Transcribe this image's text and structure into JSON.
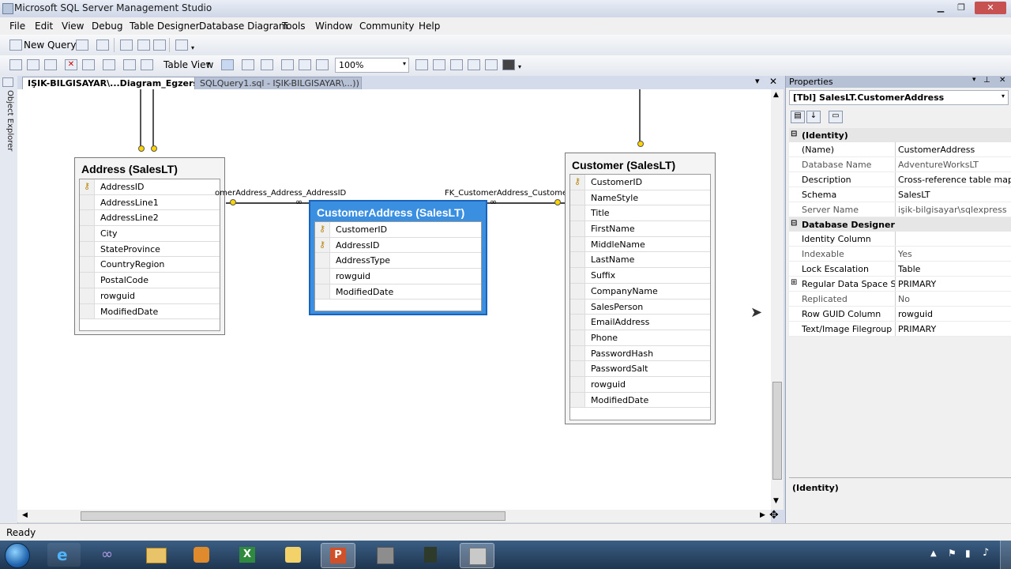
{
  "window": {
    "title": "Microsoft SQL Server Management Studio"
  },
  "menu": [
    "File",
    "Edit",
    "View",
    "Debug",
    "Table Designer",
    "Database Diagram",
    "Tools",
    "Window",
    "Community",
    "Help"
  ],
  "toolbar1": {
    "new_query": "New Query"
  },
  "toolbar2": {
    "table_view": "Table View",
    "zoom": "100%"
  },
  "left_strip": {
    "label": "Object Explorer"
  },
  "tabs": [
    {
      "label": "IŞIK-BILGISAYAR\\...Diagram_Egzersiz*",
      "active": true
    },
    {
      "label": "SQLQuery1.sql - IŞIK-BILGISAYAR\\...))",
      "active": false
    }
  ],
  "diagram": {
    "tables": [
      {
        "title": "Address (SalesLT)",
        "columns": [
          {
            "name": "AddressID",
            "key": true
          },
          {
            "name": "AddressLine1",
            "key": false
          },
          {
            "name": "AddressLine2",
            "key": false
          },
          {
            "name": "City",
            "key": false
          },
          {
            "name": "StateProvince",
            "key": false
          },
          {
            "name": "CountryRegion",
            "key": false
          },
          {
            "name": "PostalCode",
            "key": false
          },
          {
            "name": "rowguid",
            "key": false
          },
          {
            "name": "ModifiedDate",
            "key": false
          }
        ]
      },
      {
        "title": "CustomerAddress (SalesLT)",
        "selected": true,
        "columns": [
          {
            "name": "CustomerID",
            "key": true
          },
          {
            "name": "AddressID",
            "key": true
          },
          {
            "name": "AddressType",
            "key": false
          },
          {
            "name": "rowguid",
            "key": false
          },
          {
            "name": "ModifiedDate",
            "key": false
          }
        ]
      },
      {
        "title": "Customer (SalesLT)",
        "columns": [
          {
            "name": "CustomerID",
            "key": true
          },
          {
            "name": "NameStyle",
            "key": false
          },
          {
            "name": "Title",
            "key": false
          },
          {
            "name": "FirstName",
            "key": false
          },
          {
            "name": "MiddleName",
            "key": false
          },
          {
            "name": "LastName",
            "key": false
          },
          {
            "name": "Suffix",
            "key": false
          },
          {
            "name": "CompanyName",
            "key": false
          },
          {
            "name": "SalesPerson",
            "key": false
          },
          {
            "name": "EmailAddress",
            "key": false
          },
          {
            "name": "Phone",
            "key": false
          },
          {
            "name": "PasswordHash",
            "key": false
          },
          {
            "name": "PasswordSalt",
            "key": false
          },
          {
            "name": "rowguid",
            "key": false
          },
          {
            "name": "ModifiedDate",
            "key": false
          }
        ]
      }
    ],
    "relationships": [
      "omerAddress_Address_AddressID",
      "FK_CustomerAddress_Customer_"
    ]
  },
  "properties": {
    "header": "Properties",
    "object": "[Tbl] SalesLT.CustomerAddress",
    "categories": [
      {
        "name": "(Identity)",
        "items": [
          {
            "name": "(Name)",
            "value": "CustomerAddress"
          },
          {
            "name": "Database Name",
            "value": "AdventureWorksLT"
          },
          {
            "name": "Description",
            "value": "Cross-reference table mappin"
          },
          {
            "name": "Schema",
            "value": "SalesLT"
          },
          {
            "name": "Server Name",
            "value": "işik-bilgisayar\\sqlexpress"
          }
        ]
      },
      {
        "name": "Database Designer",
        "items": [
          {
            "name": "Identity Column",
            "value": ""
          },
          {
            "name": "Indexable",
            "value": "Yes"
          },
          {
            "name": "Lock Escalation",
            "value": "Table"
          },
          {
            "name": "Regular Data Space Spec",
            "value": "PRIMARY",
            "expandable": true
          },
          {
            "name": "Replicated",
            "value": "No"
          },
          {
            "name": "Row GUID Column",
            "value": "rowguid"
          },
          {
            "name": "Text/Image Filegroup",
            "value": "PRIMARY"
          }
        ]
      }
    ],
    "description_title": "(Identity)"
  },
  "status": {
    "text": "Ready"
  },
  "taskbar": {
    "apps": [
      "internet-explorer-icon",
      "visual-studio-icon",
      "file-explorer-icon",
      "media-player-icon",
      "excel-icon",
      "paint-icon",
      "powerpoint-icon",
      "box-icon",
      "camera-icon",
      "ssms-icon"
    ]
  }
}
